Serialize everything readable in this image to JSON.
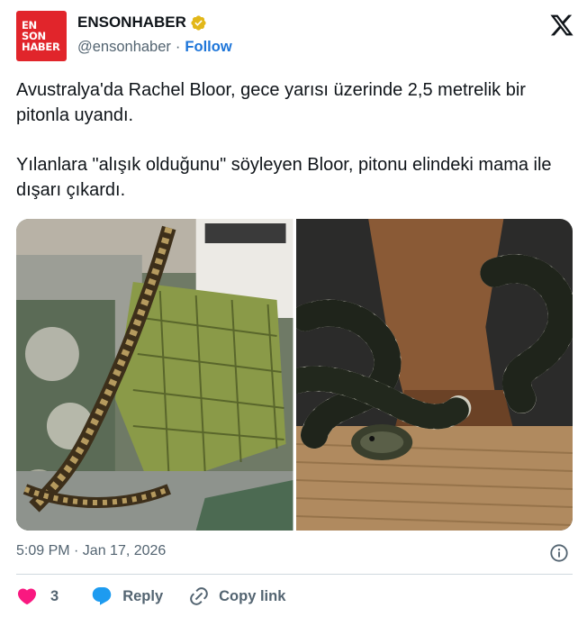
{
  "header": {
    "avatar_lines": [
      "EN",
      "SON",
      "HABER"
    ],
    "display_name": "ENSONHABER",
    "verified_icon": "verified-badge-gold",
    "handle": "@ensonhaber",
    "separator": "·",
    "follow_label": "Follow",
    "platform_icon": "x-logo"
  },
  "tweet": {
    "paragraphs": [
      "Avustralya'da Rachel Bloor, gece yarısı üzerinde 2,5 metrelik bir pitonla uyandı.",
      "Yılanlara \"alışık olduğunu\" söyleyen Bloor, pitonu elindeki mama ile dışarı çıkardı."
    ],
    "media": [
      "python-on-bed-photo",
      "python-coiled-on-rug-photo"
    ],
    "timestamp": "5:09 PM · Jan 17, 2026",
    "info_icon": "info-icon"
  },
  "actions": {
    "like_count": "3",
    "reply_label": "Reply",
    "copy_link_label": "Copy link"
  },
  "colors": {
    "brand_red": "#e1252b",
    "link_blue": "#1d75d9",
    "like_red": "#f91880",
    "reply_blue": "#1d9bf0",
    "muted": "#536471"
  }
}
